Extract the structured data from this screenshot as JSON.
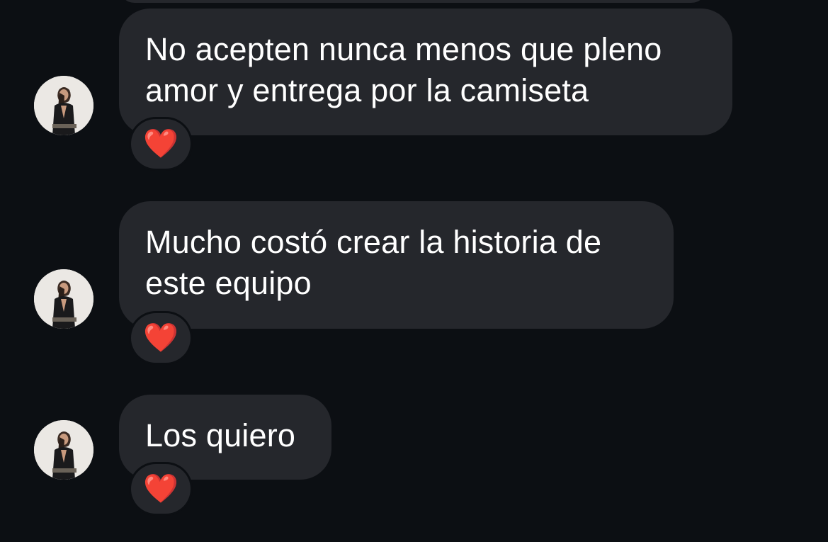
{
  "messages": [
    {
      "lines": [
        "No acepten nunca menos que pleno",
        "amor y entrega por la camiseta"
      ],
      "reaction": "❤️"
    },
    {
      "lines": [
        "Mucho costó crear la historia de",
        "este equipo"
      ],
      "reaction": "❤️"
    },
    {
      "lines": [
        "Los quiero"
      ],
      "reaction": "❤️"
    }
  ],
  "colors": {
    "background": "#0c0f13",
    "bubble": "#25272c",
    "text": "#ffffff",
    "heart": "#e5202c"
  },
  "icons": [
    "avatar",
    "heart-icon"
  ]
}
